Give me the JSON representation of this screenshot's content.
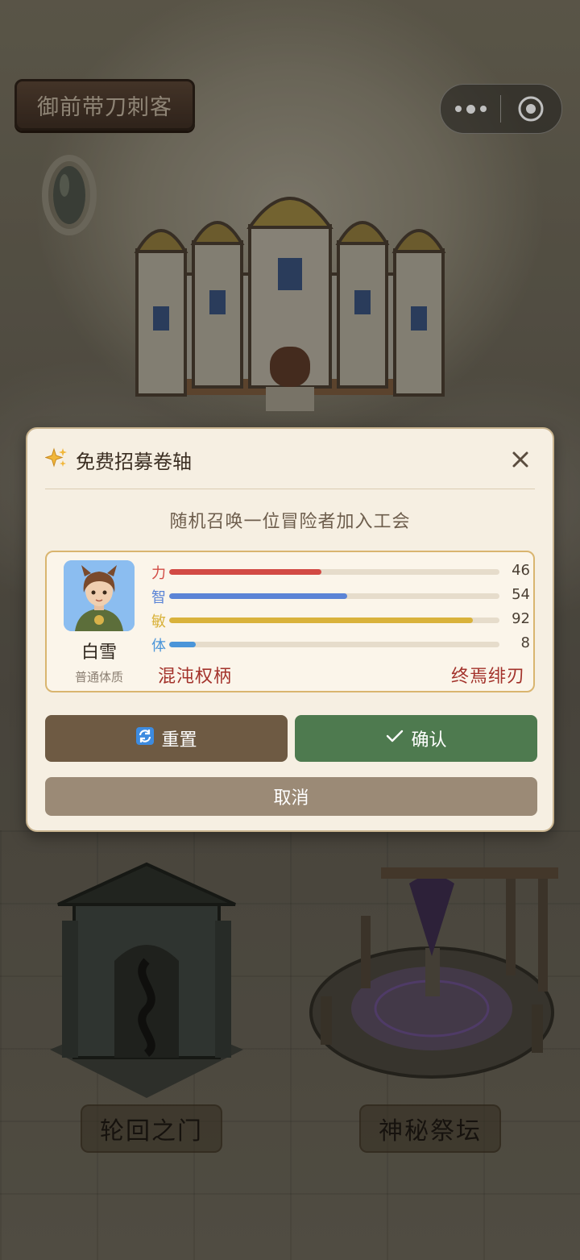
{
  "game": {
    "title": "御前带刀刺客",
    "places": [
      {
        "label": "轮回之门"
      },
      {
        "label": "神秘祭坛"
      }
    ]
  },
  "capsule": {
    "more_icon": "ellipsis-icon",
    "close_icon": "target-circle-icon"
  },
  "dialog": {
    "icon": "sparkles-icon",
    "title": "免费招募卷轴",
    "subtitle": "随机召唤一位冒险者加入工会",
    "hero": {
      "name": "白雪",
      "constitution": "普通体质",
      "stats": [
        {
          "label": "力",
          "value": 46,
          "max": 100,
          "color": "#d24a44"
        },
        {
          "label": "智",
          "value": 54,
          "max": 100,
          "color": "#5b84d6"
        },
        {
          "label": "敏",
          "value": 92,
          "max": 100,
          "color": "#d9b23b"
        },
        {
          "label": "体",
          "value": 8,
          "max": 100,
          "color": "#4a95d9"
        }
      ],
      "skills": [
        "混沌权柄",
        "终焉绯刃"
      ]
    },
    "buttons": {
      "reset": "重置",
      "confirm": "确认",
      "cancel": "取消"
    }
  }
}
